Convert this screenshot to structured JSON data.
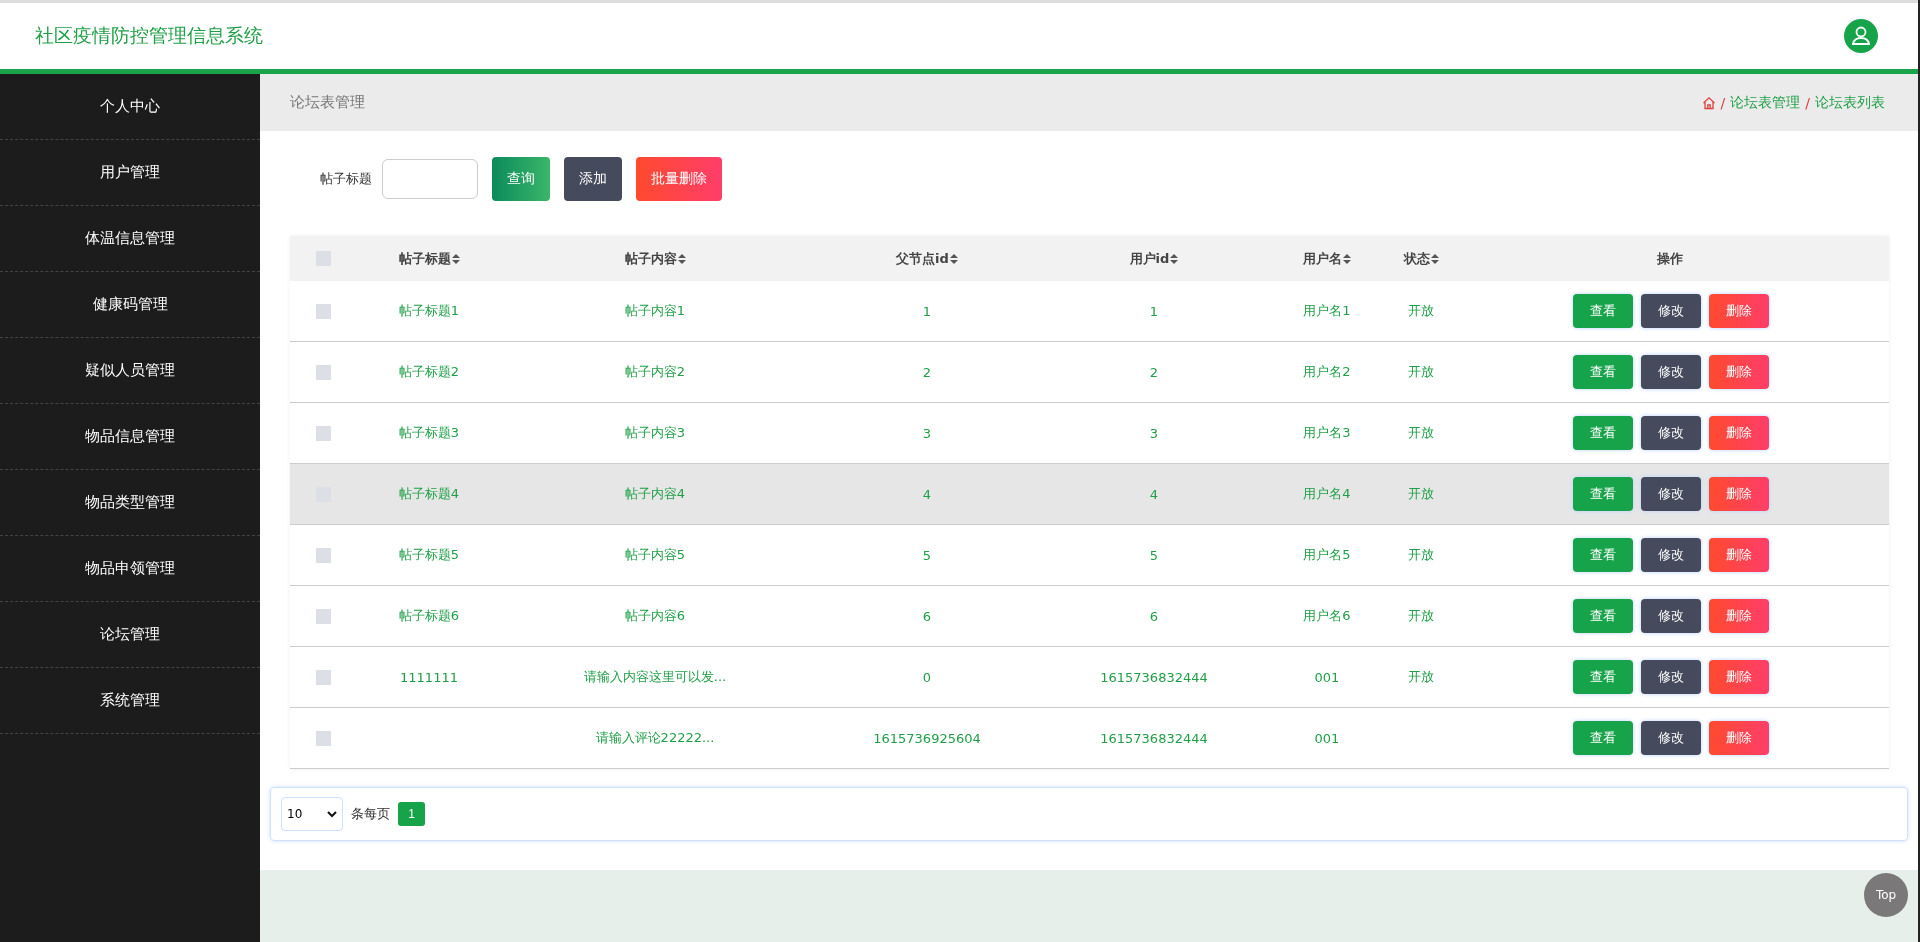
{
  "header": {
    "title": "社区疫情防控管理信息系统"
  },
  "sidebar": {
    "items": [
      {
        "label": "个人中心"
      },
      {
        "label": "用户管理"
      },
      {
        "label": "体温信息管理"
      },
      {
        "label": "健康码管理"
      },
      {
        "label": "疑似人员管理"
      },
      {
        "label": "物品信息管理"
      },
      {
        "label": "物品类型管理"
      },
      {
        "label": "物品申领管理"
      },
      {
        "label": "论坛管理"
      },
      {
        "label": "系统管理"
      }
    ]
  },
  "page_bar": {
    "title": "论坛表管理",
    "breadcrumb": [
      {
        "separator": "/",
        "label": "论坛表管理"
      },
      {
        "separator": "/",
        "label": "论坛表列表"
      }
    ]
  },
  "search": {
    "label": "帖子标题",
    "buttons": [
      {
        "label": "查询",
        "kind": "search"
      },
      {
        "label": "添加",
        "kind": "add"
      },
      {
        "label": "批量删除",
        "kind": "delete"
      }
    ]
  },
  "table": {
    "select_all_checked": false,
    "columns": [
      {
        "label": "帖子标题",
        "sortable": true
      },
      {
        "label": "帖子内容",
        "sortable": true
      },
      {
        "label": "父节点id",
        "sortable": true
      },
      {
        "label": "用户id",
        "sortable": true
      },
      {
        "label": "用户名",
        "sortable": true
      },
      {
        "label": "状态",
        "sortable": true
      },
      {
        "label": "操作",
        "sortable": false
      }
    ],
    "rows": [
      {
        "checked": false,
        "hovered": false,
        "cells": [
          "帖子标题1",
          "帖子内容1",
          "1",
          "1",
          "用户名1",
          "开放"
        ],
        "actions": [
          {
            "label": "查看",
            "kind": "view"
          },
          {
            "label": "修改",
            "kind": "edit"
          },
          {
            "label": "删除",
            "kind": "delete"
          }
        ]
      },
      {
        "checked": false,
        "hovered": false,
        "cells": [
          "帖子标题2",
          "帖子内容2",
          "2",
          "2",
          "用户名2",
          "开放"
        ],
        "actions": [
          {
            "label": "查看",
            "kind": "view"
          },
          {
            "label": "修改",
            "kind": "edit"
          },
          {
            "label": "删除",
            "kind": "delete"
          }
        ]
      },
      {
        "checked": false,
        "hovered": false,
        "cells": [
          "帖子标题3",
          "帖子内容3",
          "3",
          "3",
          "用户名3",
          "开放"
        ],
        "actions": [
          {
            "label": "查看",
            "kind": "view"
          },
          {
            "label": "修改",
            "kind": "edit"
          },
          {
            "label": "删除",
            "kind": "delete"
          }
        ]
      },
      {
        "checked": false,
        "hovered": true,
        "cells": [
          "帖子标题4",
          "帖子内容4",
          "4",
          "4",
          "用户名4",
          "开放"
        ],
        "actions": [
          {
            "label": "查看",
            "kind": "view"
          },
          {
            "label": "修改",
            "kind": "edit"
          },
          {
            "label": "删除",
            "kind": "delete"
          }
        ]
      },
      {
        "checked": false,
        "hovered": false,
        "cells": [
          "帖子标题5",
          "帖子内容5",
          "5",
          "5",
          "用户名5",
          "开放"
        ],
        "actions": [
          {
            "label": "查看",
            "kind": "view"
          },
          {
            "label": "修改",
            "kind": "edit"
          },
          {
            "label": "删除",
            "kind": "delete"
          }
        ]
      },
      {
        "checked": false,
        "hovered": false,
        "cells": [
          "帖子标题6",
          "帖子内容6",
          "6",
          "6",
          "用户名6",
          "开放"
        ],
        "actions": [
          {
            "label": "查看",
            "kind": "view"
          },
          {
            "label": "修改",
            "kind": "edit"
          },
          {
            "label": "删除",
            "kind": "delete"
          }
        ]
      },
      {
        "checked": false,
        "hovered": false,
        "cells": [
          "1111111",
          "请输入内容这里可以发...",
          "0",
          "1615736832444",
          "001",
          "开放"
        ],
        "actions": [
          {
            "label": "查看",
            "kind": "view"
          },
          {
            "label": "修改",
            "kind": "edit"
          },
          {
            "label": "删除",
            "kind": "delete"
          }
        ]
      },
      {
        "checked": false,
        "hovered": false,
        "cells": [
          "",
          "请输入评论22222...",
          "1615736925604",
          "1615736832444",
          "001",
          ""
        ],
        "actions": [
          {
            "label": "查看",
            "kind": "view"
          },
          {
            "label": "修改",
            "kind": "edit"
          },
          {
            "label": "删除",
            "kind": "delete"
          }
        ]
      }
    ]
  },
  "pagination": {
    "page_size": "10",
    "per_page_label": "条每页",
    "pages": [
      {
        "label": "1",
        "selected": true
      }
    ]
  },
  "back_to_top": {
    "label": "Top"
  }
}
